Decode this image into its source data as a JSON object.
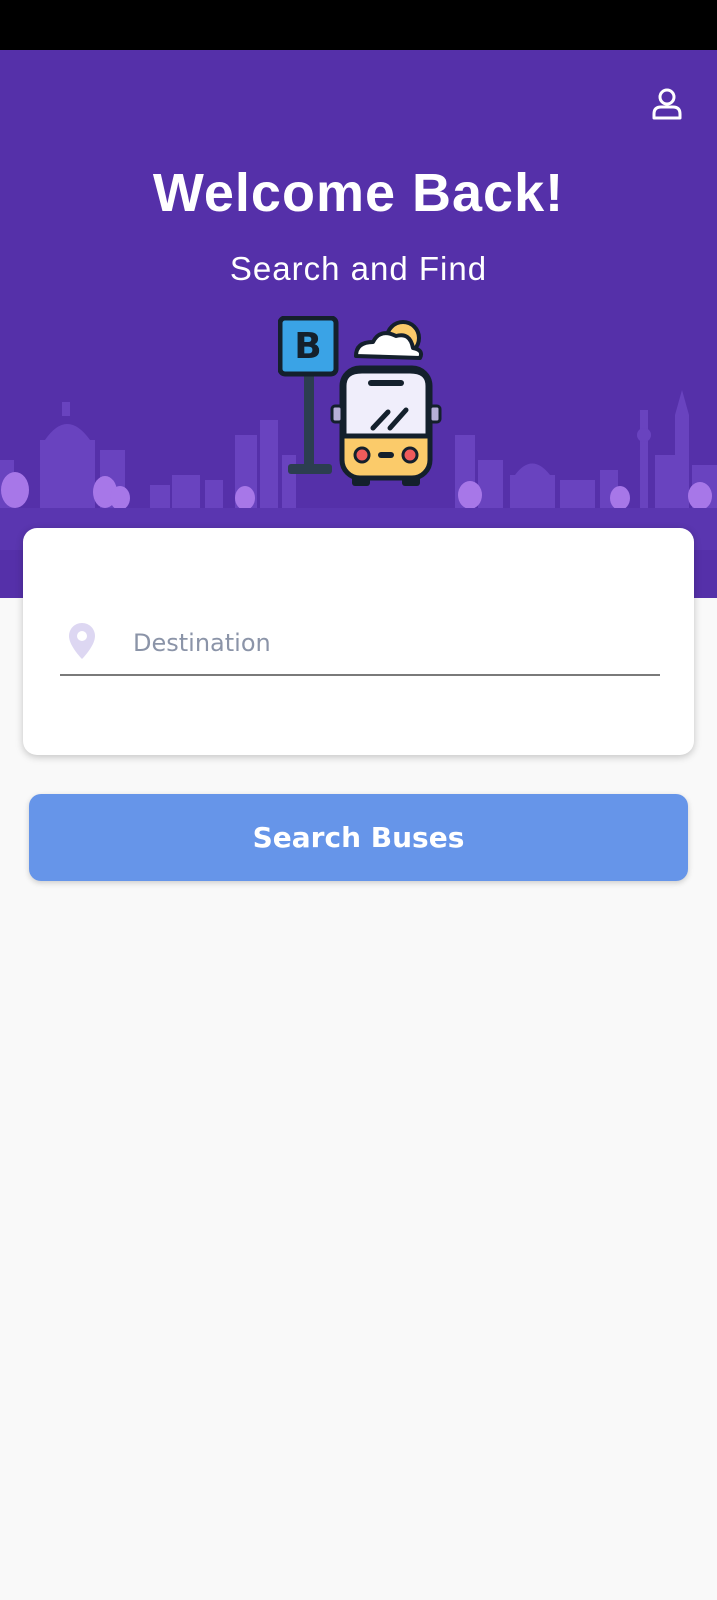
{
  "header": {
    "title": "Welcome Back!",
    "subtitle": "Search and Find",
    "profile_icon": "user-icon",
    "illustration": {
      "sign_letter": "B",
      "icons": [
        "bus-stop-sign-icon",
        "bus-icon",
        "cloud-icon"
      ]
    }
  },
  "search": {
    "destination_placeholder": "Destination",
    "destination_value": "",
    "location_icon": "location-pin-icon",
    "button_label": "Search Buses"
  },
  "colors": {
    "primary": "#5530a9",
    "button": "#6695e9",
    "background": "#f9f9f9",
    "bus_yellow": "#fbcb6a",
    "sign_blue": "#3aa3e6"
  }
}
